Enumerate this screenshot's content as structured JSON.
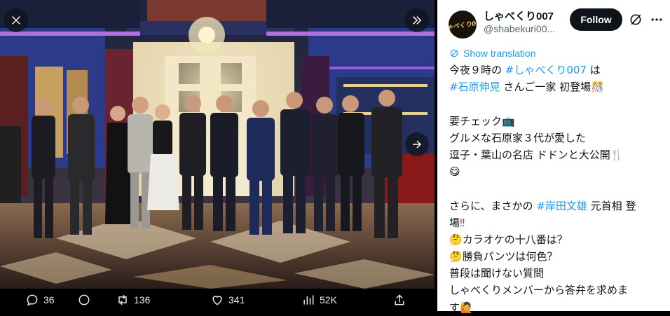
{
  "account": {
    "display_name": "しゃべくり007",
    "handle": "@shabekuri00...",
    "avatar_logo": "しゃべくり007",
    "follow_label": "Follow"
  },
  "translate_label": "Show translation",
  "tweet": {
    "l1a": "今夜９時の ",
    "l1tag": "#しゃべくり007",
    "l1b": " は",
    "l2tag": "#石原伸晃",
    "l2b": " さんご一家 初登場",
    "l3": "要チェック",
    "l4": "グルメな石原家３代が愛した",
    "l5": "逗子・葉山の名店 ドドンと大公開",
    "l7a": "さらに、まさかの ",
    "l7tag": "#岸田文雄",
    "l7b": " 元首相 登",
    "l8": "場",
    "l9": "カラオケの十八番は？",
    "l10": "勝負パンツは何色？",
    "l11": "普段は聞けない質問",
    "l12": "しゃべくりメンバーから答弁を求めま",
    "l13": "す"
  },
  "actions": {
    "replies": "36",
    "reposts": "136",
    "likes": "341",
    "views": "52K"
  },
  "colors": {
    "link": "#1d9bf0",
    "text": "#0f1419",
    "secondary": "#536471"
  }
}
